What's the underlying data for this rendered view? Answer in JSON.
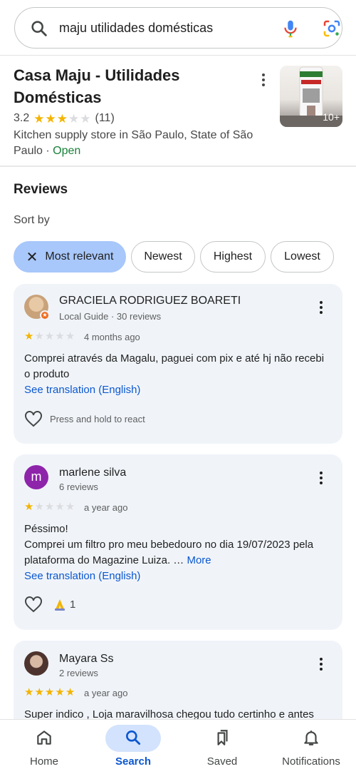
{
  "search": {
    "query": "maju utilidades domésticas"
  },
  "business": {
    "name": "Casa Maju - Utilidades Domésticas",
    "rating": "3.2",
    "review_count": "(11)",
    "stars": 3,
    "category": "Kitchen supply store in São Paulo, State of São Paulo",
    "separator": " · ",
    "status": "Open",
    "photo_count": "10+"
  },
  "reviews_section": {
    "heading": "Reviews",
    "sort_label": "Sort by",
    "chips": [
      "Most relevant",
      "Newest",
      "Highest",
      "Lowest"
    ],
    "selected_chip": "Most relevant"
  },
  "reviews": [
    {
      "name": "GRACIELA RODRIGUEZ BOARETI",
      "subtitle": "Local Guide · 30 reviews",
      "stars": 1,
      "time": "4 months ago",
      "text_lines": [
        "Comprei através da Magalu, paguei com pix e até hj não recebi",
        "o produto"
      ],
      "translation": "See translation (English)",
      "react_hint": "Press and hold to react",
      "avatar_color": "#c9a27a"
    },
    {
      "name": "marlene silva",
      "subtitle": "6 reviews",
      "stars": 1,
      "time": "a year ago",
      "avatar_letter": "m",
      "text_lines": [
        "Péssimo!",
        "Comprei um filtro pro meu bebedouro no dia 19/07/2023 pela",
        "plataforma do Magazine Luiza. … "
      ],
      "more": "More",
      "translation": "See translation (English)",
      "reaction_count": "1",
      "avatar_color": "#8e24aa"
    },
    {
      "name": "Mayara Ss",
      "subtitle": "2 reviews",
      "stars": 5,
      "time": "a year ago",
      "text_lines": [
        "Super indico , Loja maravilhosa chegou tudo certinho e antes"
      ],
      "avatar_color": "#6d5a52"
    }
  ],
  "bottom_nav": {
    "items": [
      "Home",
      "Search",
      "Saved",
      "Notifications"
    ],
    "active": "Search"
  },
  "colors": {
    "accent": "#0b57d0",
    "selected_chip": "#a8c7fa",
    "star": "#f4b400",
    "open": "#188038"
  }
}
